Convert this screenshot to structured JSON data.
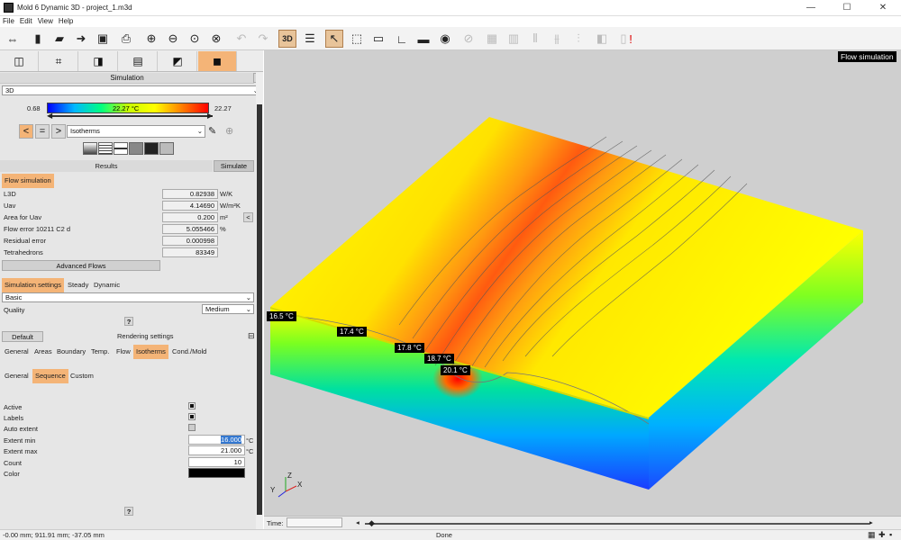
{
  "window": {
    "title": "Mold 6 Dynamic 3D - project_1.m3d",
    "min": "—",
    "max": "☐",
    "close": "✕"
  },
  "menu": [
    "File",
    "Edit",
    "View",
    "Help"
  ],
  "toolbar": {
    "view3d": "3D"
  },
  "simulation": {
    "header": "Simulation",
    "mode": "3D",
    "scale_min": "0.68",
    "scale_mid": "22.27 °C",
    "scale_max": "22.27",
    "lt": "<",
    "eq": "=",
    "gt": ">",
    "display": "Isotherms",
    "results_label": "Results",
    "simulate_label": "Simulate",
    "flow_tab": "Flow simulation",
    "results": [
      {
        "name": "L3D",
        "value": "0.82938",
        "unit": "W/K"
      },
      {
        "name": "Uav",
        "value": "4.14690",
        "unit": "W/m²K"
      },
      {
        "name": "Area for Uav",
        "value": "0.200",
        "unit": "m²"
      },
      {
        "name": "Flow error 10211 C2 d",
        "value": "5.055466",
        "unit": "%"
      },
      {
        "name": "Residual error",
        "value": "0.000998",
        "unit": ""
      },
      {
        "name": "Tetrahedrons",
        "value": "83349",
        "unit": ""
      }
    ],
    "advanced": "Advanced Flows"
  },
  "sim_settings": {
    "tabs": [
      "Simulation settings",
      "Steady",
      "Dynamic"
    ],
    "preset": "Basic",
    "quality_label": "Quality",
    "quality": "Medium",
    "help": "?"
  },
  "rendering": {
    "default_btn": "Default",
    "header": "Rendering settings",
    "tabs": [
      "General",
      "Areas",
      "Boundary",
      "Temp.",
      "Flow",
      "Isotherms",
      "Cond./Mold"
    ],
    "subtabs": [
      "General",
      "Sequence",
      "Custom"
    ],
    "active_label": "Active",
    "labels_label": "Labels",
    "auto_label": "Auto extent",
    "min_label": "Extent min",
    "min_value": "16.000",
    "min_unit": "°C",
    "max_label": "Extent max",
    "max_value": "21.000",
    "max_unit": "°C",
    "count_label": "Count",
    "count_value": "10",
    "color_label": "Color",
    "color_value": "#000000",
    "help": "?"
  },
  "viewport": {
    "badge": "Flow simulation",
    "labels": [
      "16.5 °C",
      "17.4 °C",
      "17.8 °C",
      "18.7 °C",
      "20.1 °C"
    ],
    "axes": {
      "x": "X",
      "y": "Y",
      "z": "Z"
    }
  },
  "bottombar": {
    "time_label": "Time:",
    "time_value": ""
  },
  "status": {
    "coords": "-0.00 mm; 911.91 mm; -37.05 mm",
    "state": "Done"
  }
}
